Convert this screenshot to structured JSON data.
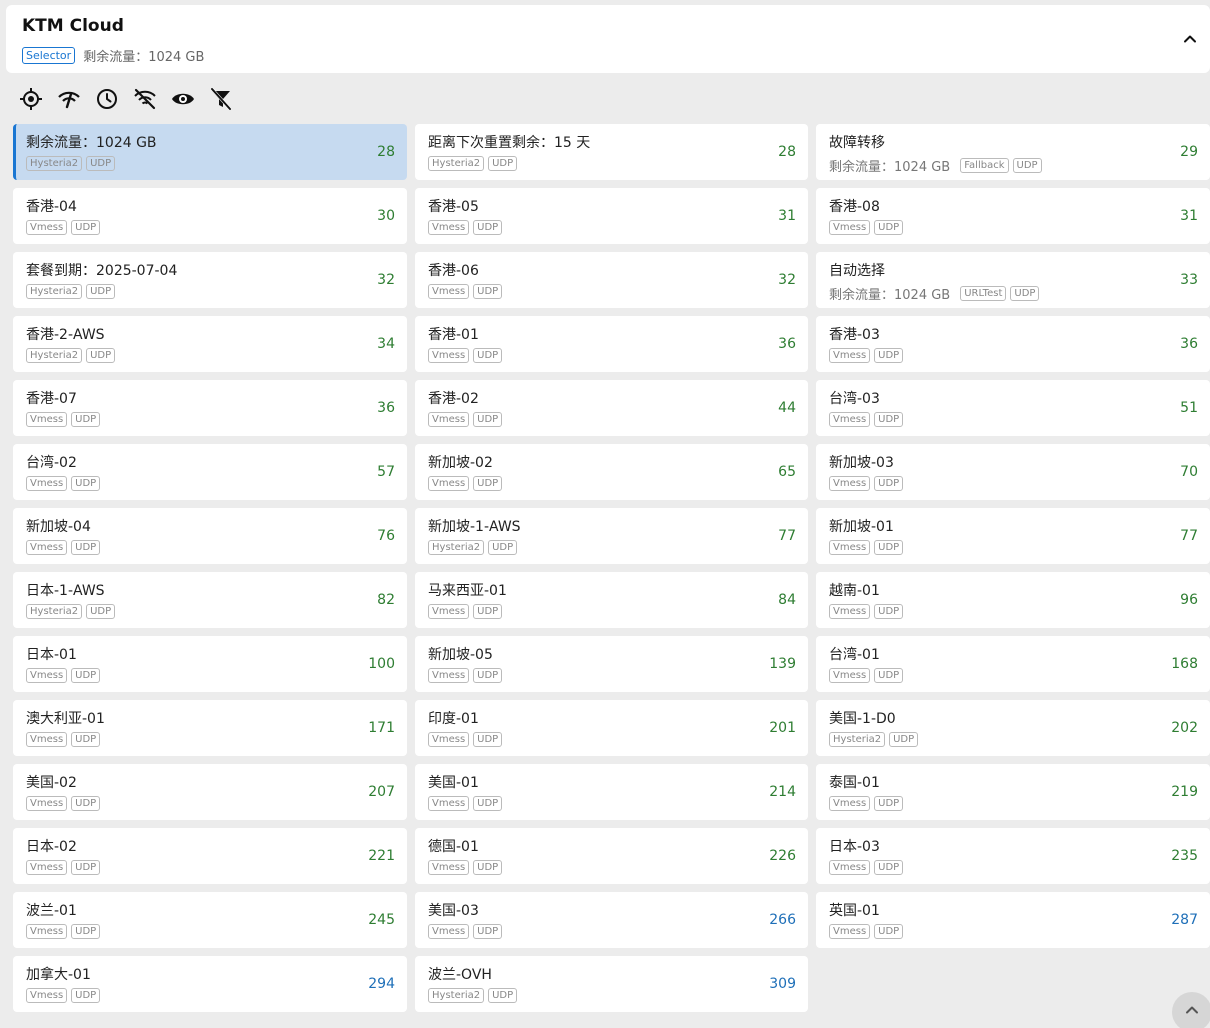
{
  "header": {
    "title": "KTM Cloud",
    "type_badge": "Selector",
    "info": "剩余流量：1024 GB"
  },
  "toolbar": {
    "icons": [
      "locate-icon",
      "delay-test-icon",
      "sort-by-delay-icon",
      "hide-unavailable-icon",
      "show-icon",
      "filter-off-icon"
    ]
  },
  "proxies": [
    {
      "name": "剩余流量：1024 GB",
      "extra": "",
      "tags": [
        "Hysteria2",
        "UDP"
      ],
      "delay": "28",
      "selected": true
    },
    {
      "name": "距离下次重置剩余：15 天",
      "extra": "",
      "tags": [
        "Hysteria2",
        "UDP"
      ],
      "delay": "28"
    },
    {
      "name": "故障转移",
      "extra": "剩余流量：1024 GB",
      "tags": [
        "Fallback",
        "UDP"
      ],
      "delay": "29"
    },
    {
      "name": "香港-04",
      "extra": "",
      "tags": [
        "Vmess",
        "UDP"
      ],
      "delay": "30"
    },
    {
      "name": "香港-05",
      "extra": "",
      "tags": [
        "Vmess",
        "UDP"
      ],
      "delay": "31"
    },
    {
      "name": "香港-08",
      "extra": "",
      "tags": [
        "Vmess",
        "UDP"
      ],
      "delay": "31"
    },
    {
      "name": "套餐到期：2025-07-04",
      "extra": "",
      "tags": [
        "Hysteria2",
        "UDP"
      ],
      "delay": "32"
    },
    {
      "name": "香港-06",
      "extra": "",
      "tags": [
        "Vmess",
        "UDP"
      ],
      "delay": "32"
    },
    {
      "name": "自动选择",
      "extra": "剩余流量：1024 GB",
      "tags": [
        "URLTest",
        "UDP"
      ],
      "delay": "33"
    },
    {
      "name": "香港-2-AWS",
      "extra": "",
      "tags": [
        "Hysteria2",
        "UDP"
      ],
      "delay": "34"
    },
    {
      "name": "香港-01",
      "extra": "",
      "tags": [
        "Vmess",
        "UDP"
      ],
      "delay": "36"
    },
    {
      "name": "香港-03",
      "extra": "",
      "tags": [
        "Vmess",
        "UDP"
      ],
      "delay": "36"
    },
    {
      "name": "香港-07",
      "extra": "",
      "tags": [
        "Vmess",
        "UDP"
      ],
      "delay": "36"
    },
    {
      "name": "香港-02",
      "extra": "",
      "tags": [
        "Vmess",
        "UDP"
      ],
      "delay": "44"
    },
    {
      "name": "台湾-03",
      "extra": "",
      "tags": [
        "Vmess",
        "UDP"
      ],
      "delay": "51"
    },
    {
      "name": "台湾-02",
      "extra": "",
      "tags": [
        "Vmess",
        "UDP"
      ],
      "delay": "57"
    },
    {
      "name": "新加坡-02",
      "extra": "",
      "tags": [
        "Vmess",
        "UDP"
      ],
      "delay": "65"
    },
    {
      "name": "新加坡-03",
      "extra": "",
      "tags": [
        "Vmess",
        "UDP"
      ],
      "delay": "70"
    },
    {
      "name": "新加坡-04",
      "extra": "",
      "tags": [
        "Vmess",
        "UDP"
      ],
      "delay": "76"
    },
    {
      "name": "新加坡-1-AWS",
      "extra": "",
      "tags": [
        "Hysteria2",
        "UDP"
      ],
      "delay": "77"
    },
    {
      "name": "新加坡-01",
      "extra": "",
      "tags": [
        "Vmess",
        "UDP"
      ],
      "delay": "77"
    },
    {
      "name": "日本-1-AWS",
      "extra": "",
      "tags": [
        "Hysteria2",
        "UDP"
      ],
      "delay": "82"
    },
    {
      "name": "马来西亚-01",
      "extra": "",
      "tags": [
        "Vmess",
        "UDP"
      ],
      "delay": "84"
    },
    {
      "name": "越南-01",
      "extra": "",
      "tags": [
        "Vmess",
        "UDP"
      ],
      "delay": "96"
    },
    {
      "name": "日本-01",
      "extra": "",
      "tags": [
        "Vmess",
        "UDP"
      ],
      "delay": "100"
    },
    {
      "name": "新加坡-05",
      "extra": "",
      "tags": [
        "Vmess",
        "UDP"
      ],
      "delay": "139"
    },
    {
      "name": "台湾-01",
      "extra": "",
      "tags": [
        "Vmess",
        "UDP"
      ],
      "delay": "168"
    },
    {
      "name": "澳大利亚-01",
      "extra": "",
      "tags": [
        "Vmess",
        "UDP"
      ],
      "delay": "171"
    },
    {
      "name": "印度-01",
      "extra": "",
      "tags": [
        "Vmess",
        "UDP"
      ],
      "delay": "201"
    },
    {
      "name": "美国-1-D0",
      "extra": "",
      "tags": [
        "Hysteria2",
        "UDP"
      ],
      "delay": "202"
    },
    {
      "name": "美国-02",
      "extra": "",
      "tags": [
        "Vmess",
        "UDP"
      ],
      "delay": "207"
    },
    {
      "name": "美国-01",
      "extra": "",
      "tags": [
        "Vmess",
        "UDP"
      ],
      "delay": "214"
    },
    {
      "name": "泰国-01",
      "extra": "",
      "tags": [
        "Vmess",
        "UDP"
      ],
      "delay": "219"
    },
    {
      "name": "日本-02",
      "extra": "",
      "tags": [
        "Vmess",
        "UDP"
      ],
      "delay": "221"
    },
    {
      "name": "德国-01",
      "extra": "",
      "tags": [
        "Vmess",
        "UDP"
      ],
      "delay": "226"
    },
    {
      "name": "日本-03",
      "extra": "",
      "tags": [
        "Vmess",
        "UDP"
      ],
      "delay": "235"
    },
    {
      "name": "波兰-01",
      "extra": "",
      "tags": [
        "Vmess",
        "UDP"
      ],
      "delay": "245"
    },
    {
      "name": "美国-03",
      "extra": "",
      "tags": [
        "Vmess",
        "UDP"
      ],
      "delay": "266",
      "color": "blue"
    },
    {
      "name": "英国-01",
      "extra": "",
      "tags": [
        "Vmess",
        "UDP"
      ],
      "delay": "287",
      "color": "blue"
    },
    {
      "name": "加拿大-01",
      "extra": "",
      "tags": [
        "Vmess",
        "UDP"
      ],
      "delay": "294",
      "color": "blue"
    },
    {
      "name": "波兰-OVH",
      "extra": "",
      "tags": [
        "Hysteria2",
        "UDP"
      ],
      "delay": "309",
      "color": "blue"
    }
  ],
  "colors": {
    "fast": "#2e7d32",
    "slow": "#1e6fb8",
    "accent": "#1976d2",
    "selected_bg": "#c6daf0"
  }
}
